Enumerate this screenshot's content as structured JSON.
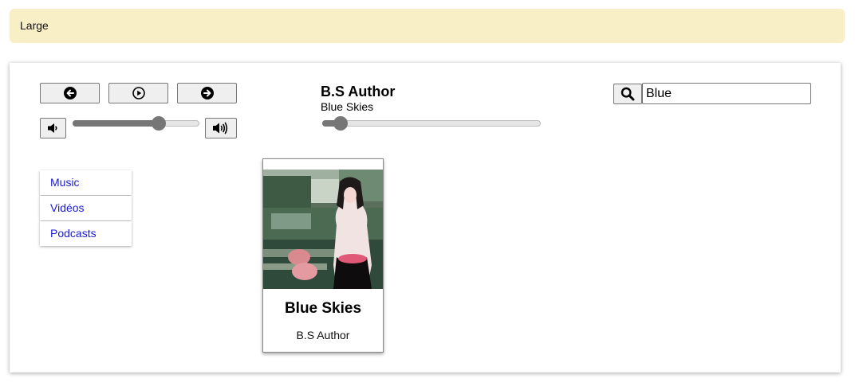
{
  "banner": {
    "label": "Large"
  },
  "player": {
    "controls": {
      "prev_icon": "arrow-left-icon",
      "play_icon": "play-icon",
      "next_icon": "arrow-right-icon",
      "volume_down_icon": "volume-low-icon",
      "volume_up_icon": "volume-high-icon"
    },
    "volume_level": 0.68,
    "progress_level": 0.08,
    "now_playing": {
      "author": "B.S Author",
      "title": "Blue Skies"
    }
  },
  "search": {
    "icon": "search-icon",
    "value": "Blue"
  },
  "nav": {
    "items": [
      {
        "label": "Music"
      },
      {
        "label": "Vidéos"
      },
      {
        "label": "Podcasts"
      }
    ]
  },
  "results": [
    {
      "title": "Blue Skies",
      "author": "B.S Author"
    }
  ],
  "colors": {
    "banner_bg": "#f8efc6",
    "link": "#1a1ad0",
    "slider": "#767676"
  }
}
